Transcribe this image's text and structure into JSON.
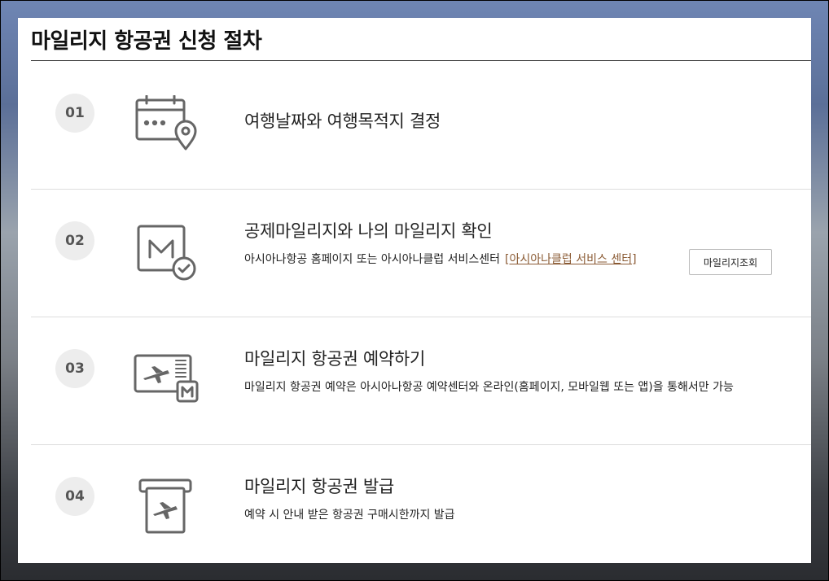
{
  "page": {
    "title": "마일리지 항공권 신청 절차"
  },
  "steps": [
    {
      "number": "01",
      "icon": "calendar-location-icon",
      "heading": "여행날짜와 여행목적지 결정"
    },
    {
      "number": "02",
      "icon": "mileage-check-icon",
      "heading": "공제마일리지와 나의 마일리지 확인",
      "description": "아시아나항공 홈페이지 또는 아시아나클럽 서비스센터",
      "link_label": "[아시아나클럽 서비스 센터]",
      "button_label": "마일리지조회"
    },
    {
      "number": "03",
      "icon": "ticket-reservation-icon",
      "heading": "마일리지 항공권 예약하기",
      "description": "마일리지 항공권 예약은 아시아나항공 예약센터와 온라인(홈페이지, 모바일웹 또는 앱)을 통해서만 가능"
    },
    {
      "number": "04",
      "icon": "ticket-issue-icon",
      "heading": "마일리지 항공권 발급",
      "description": "예약 시 안내 받은 항공권 구매시한까지 발급"
    }
  ],
  "colors": {
    "icon": "#666666",
    "link": "#8a5a33",
    "number_bg": "#ededed"
  }
}
